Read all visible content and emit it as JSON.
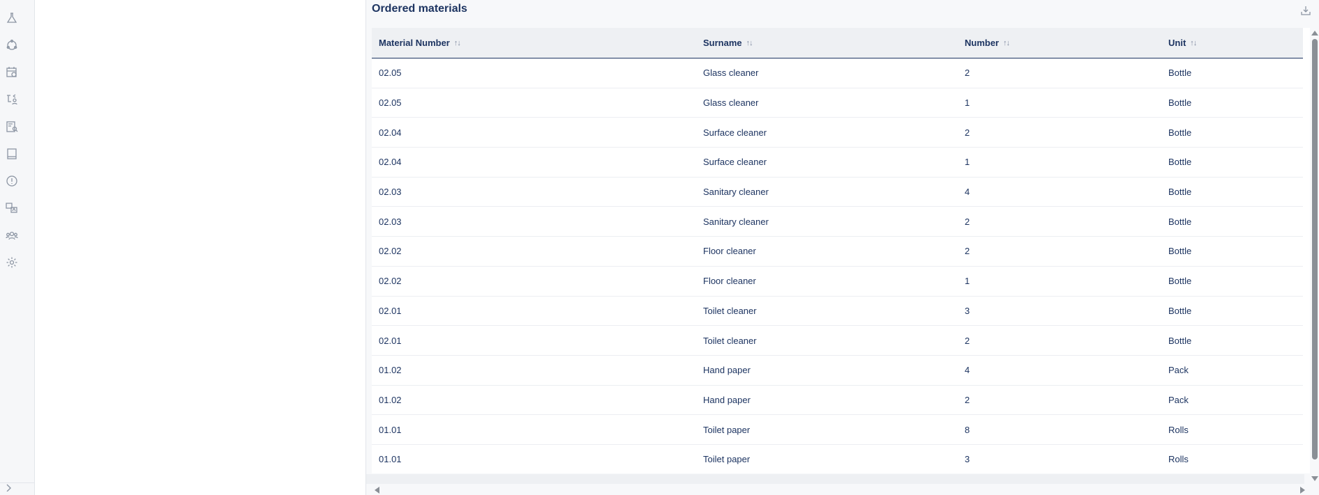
{
  "rail": {
    "icons": [
      "flask-icon",
      "cycle-icon",
      "calendar-clock-icon",
      "route-user-icon",
      "document-search-icon",
      "book-icon",
      "alert-circle-icon",
      "translate-icon",
      "group-icon",
      "settings-icon"
    ],
    "collapse_icon": "chevron-right-icon"
  },
  "main": {
    "title": "Ordered materials",
    "download_icon": "download-icon"
  },
  "table": {
    "columns": [
      "Material Number",
      "Surname",
      "Number",
      "Unit"
    ],
    "sort_glyph": "↑↓",
    "rows": [
      [
        "02.05",
        "Glass cleaner",
        "2",
        "Bottle"
      ],
      [
        "02.05",
        "Glass cleaner",
        "1",
        "Bottle"
      ],
      [
        "02.04",
        "Surface cleaner",
        "2",
        "Bottle"
      ],
      [
        "02.04",
        "Surface cleaner",
        "1",
        "Bottle"
      ],
      [
        "02.03",
        "Sanitary cleaner",
        "4",
        "Bottle"
      ],
      [
        "02.03",
        "Sanitary cleaner",
        "2",
        "Bottle"
      ],
      [
        "02.02",
        "Floor cleaner",
        "2",
        "Bottle"
      ],
      [
        "02.02",
        "Floor cleaner",
        "1",
        "Bottle"
      ],
      [
        "02.01",
        "Toilet cleaner",
        "3",
        "Bottle"
      ],
      [
        "02.01",
        "Toilet cleaner",
        "2",
        "Bottle"
      ],
      [
        "01.02",
        "Hand paper",
        "4",
        "Pack"
      ],
      [
        "01.02",
        "Hand paper",
        "2",
        "Pack"
      ],
      [
        "01.01",
        "Toilet paper",
        "8",
        "Rolls"
      ],
      [
        "01.01",
        "Toilet paper",
        "3",
        "Rolls"
      ]
    ]
  }
}
